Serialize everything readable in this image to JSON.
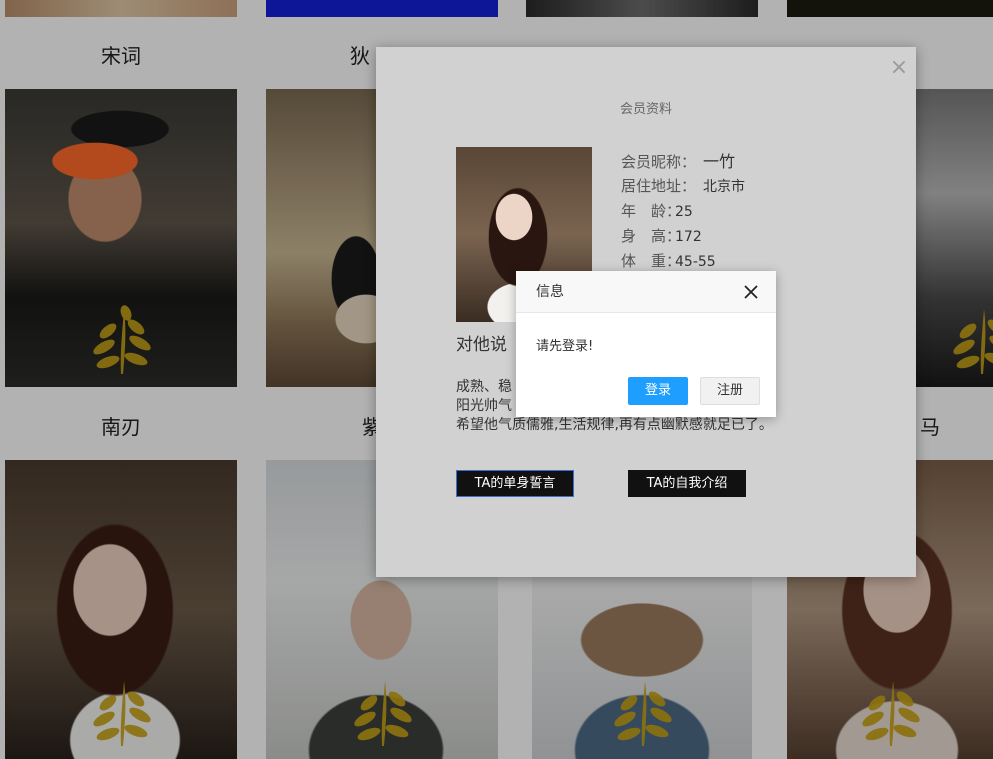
{
  "gallery": {
    "row1_names": [
      "宋词",
      "狄 ",
      "",
      ""
    ],
    "row2_names": [
      "南刃",
      "紫",
      "",
      "马"
    ],
    "leaf_color": "#c8a317"
  },
  "profile_modal": {
    "title": "会员资料",
    "close_glyph": "×",
    "fields": [
      {
        "label": "会员昵称：",
        "value": "一竹"
      },
      {
        "label": "居住地址：",
        "value": "北京市"
      },
      {
        "label": "年　龄：",
        "value": "25"
      },
      {
        "label": "身　高：",
        "value": "172"
      },
      {
        "label": "体　重：",
        "value": "45-55"
      }
    ],
    "say_label": "对他说",
    "description_lines": [
      "成熟、稳",
      "阳光帅气",
      "希望他气质儒雅,生活规律,再有点幽默感就足已了。"
    ],
    "oath_button": "TA的单身誓言",
    "intro_button": "TA的自我介绍"
  },
  "alert_dialog": {
    "title": "信息",
    "message": "请先登录!",
    "login_button": "登录",
    "register_button": "注册",
    "accent_color": "#1e9fff"
  }
}
